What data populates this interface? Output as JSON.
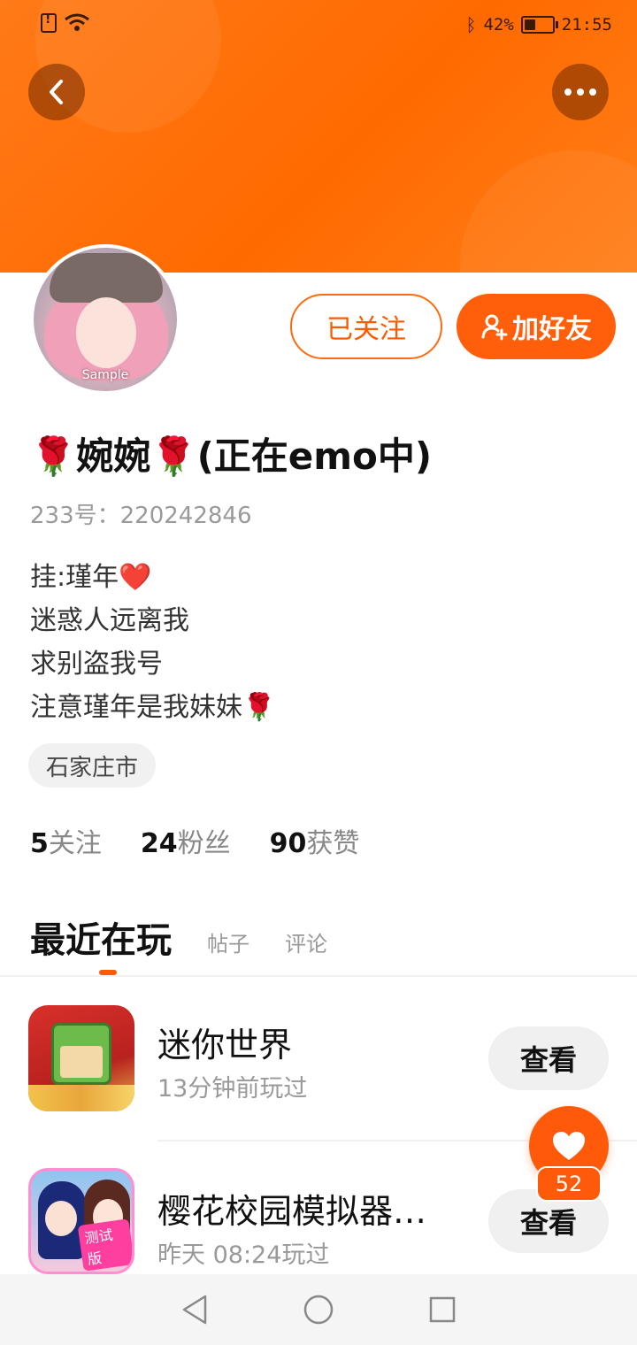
{
  "status_bar": {
    "battery": "42%",
    "battery_level": 0.42,
    "time": "21:55"
  },
  "profile": {
    "avatar_label": "Sample",
    "follow_label": "已关注",
    "add_friend_label": "加好友",
    "nickname": "🌹婉婉🌹(正在emo中)",
    "user_id": "233号：220242846",
    "bio_lines": [
      "挂:瑾年❤️",
      "迷惑人远离我",
      "求别盗我号",
      "注意瑾年是我妹妹🌹"
    ],
    "location": "石家庄市",
    "stats": [
      {
        "value": "5",
        "label": "关注"
      },
      {
        "value": "24",
        "label": "粉丝"
      },
      {
        "value": "90",
        "label": "获赞"
      }
    ]
  },
  "tabs": [
    {
      "label": "最近在玩",
      "active": true
    },
    {
      "label": "帖子",
      "active": false
    },
    {
      "label": "评论",
      "active": false
    }
  ],
  "games": [
    {
      "title": "迷你世界",
      "time": "13分钟前玩过",
      "button": "查看",
      "icon": "mini-world-icon"
    },
    {
      "title": "樱花校园模拟器…",
      "time": "昨天 08:24玩过",
      "button": "查看",
      "icon": "sakura-school-icon",
      "icon_badge": "测试版"
    }
  ],
  "like": {
    "count": "52"
  },
  "colors": {
    "accent": "#ff5f0a",
    "header": "#ff6a00"
  }
}
